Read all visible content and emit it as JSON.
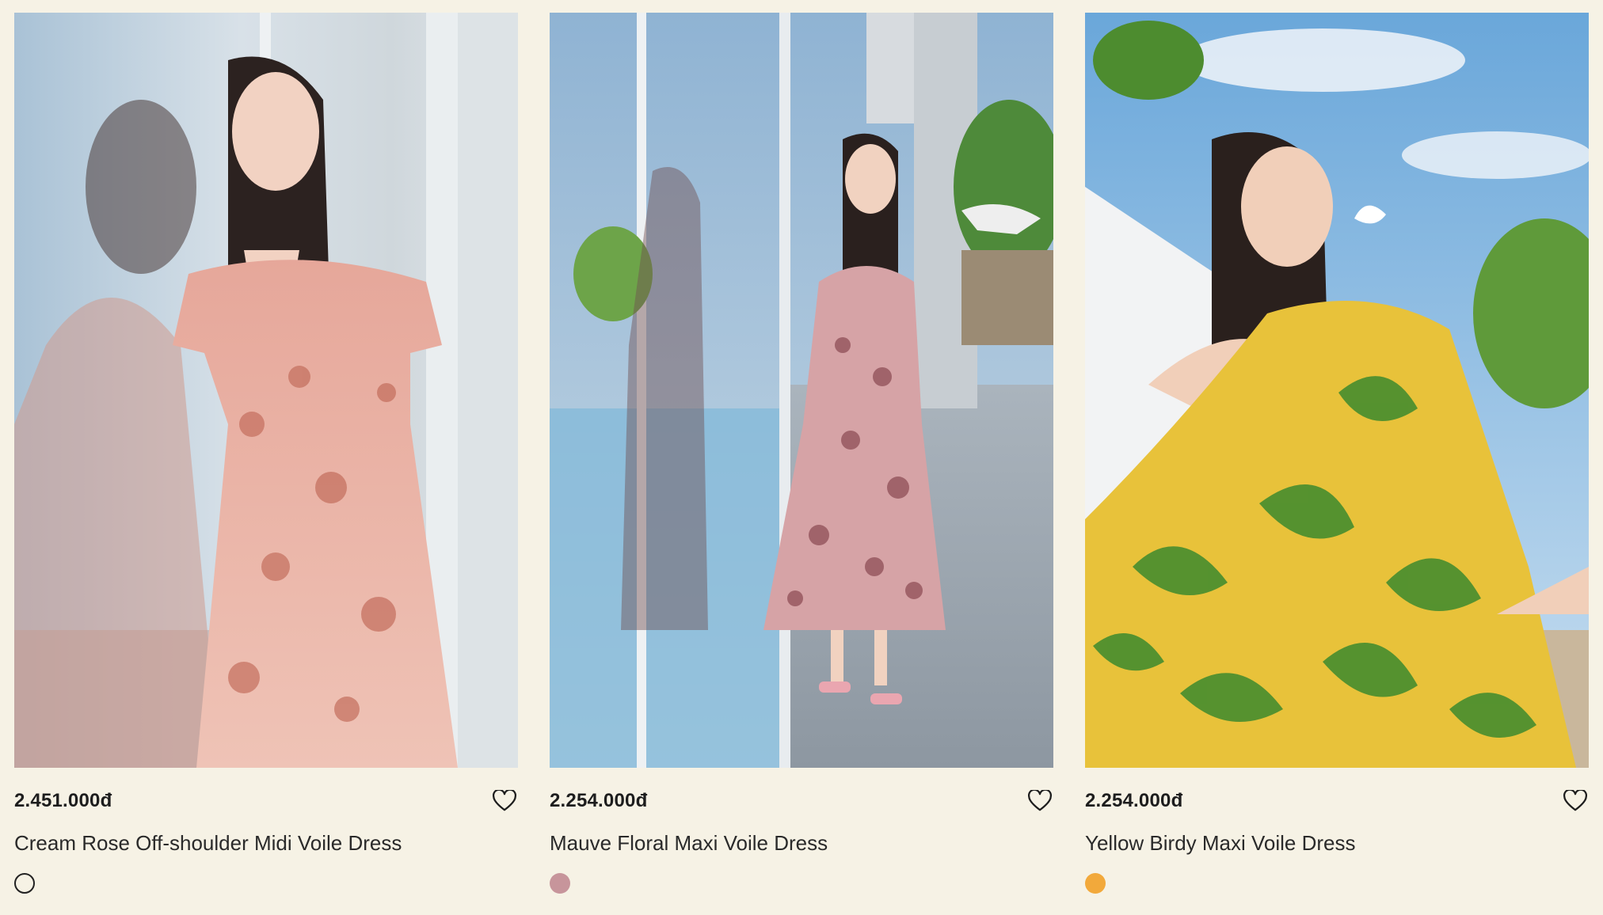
{
  "products": [
    {
      "price": "2.451.000đ",
      "name": "Cream Rose Off-shoulder Midi Voile Dress",
      "swatch": "#f6f2e5",
      "swatch_border": "#222222",
      "wishlist_icon": "heart-outline-icon"
    },
    {
      "price": "2.254.000đ",
      "name": "Mauve Floral Maxi Voile Dress",
      "swatch": "#c7959b",
      "swatch_border": "#c7959b",
      "wishlist_icon": "heart-outline-icon"
    },
    {
      "price": "2.254.000đ",
      "name": "Yellow Birdy Maxi Voile Dress",
      "swatch": "#f2a93b",
      "swatch_border": "#f2a93b",
      "wishlist_icon": "heart-outline-icon"
    }
  ],
  "colors": {
    "background": "#f6f2e5",
    "text": "#1d1d1d"
  }
}
